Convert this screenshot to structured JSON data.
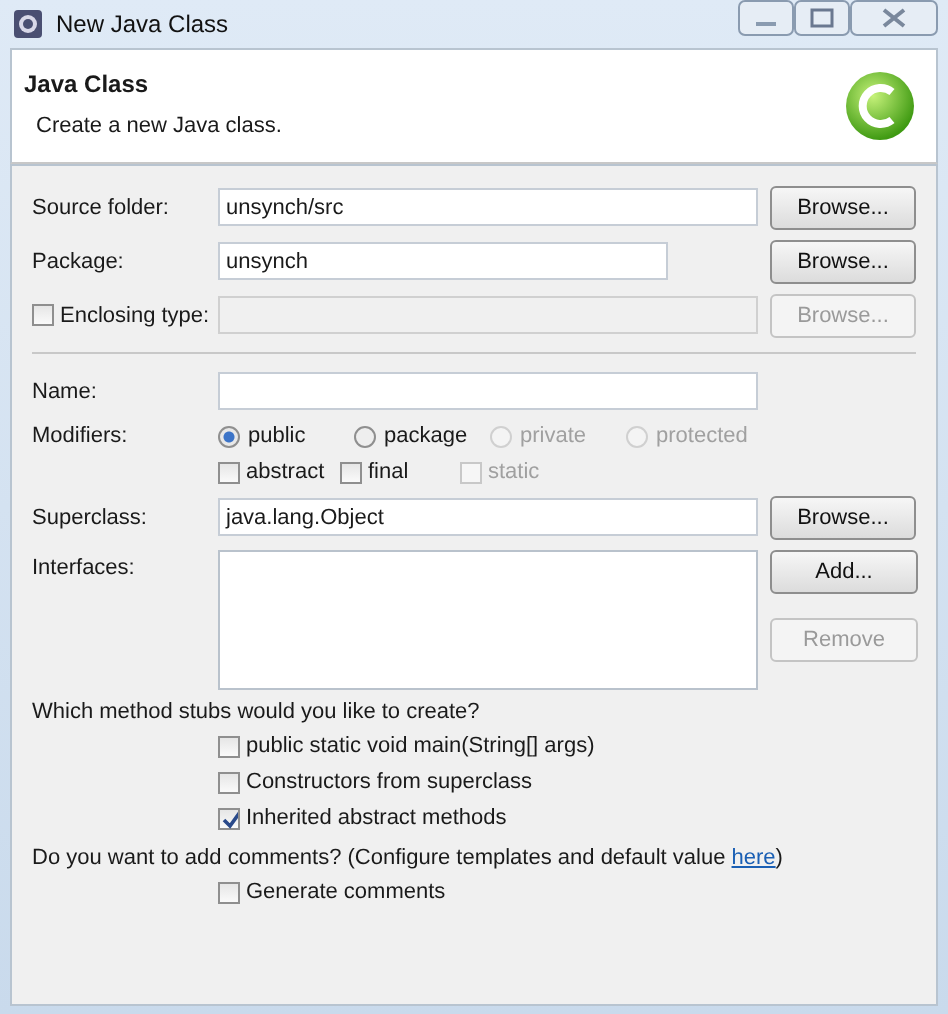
{
  "window": {
    "title": "New Java Class"
  },
  "header": {
    "title": "Java Class",
    "description": "Create a new Java class."
  },
  "location_rows": [
    {
      "kind": "text",
      "label": "Source folder:",
      "value": "unsynch/src",
      "field_disabled": false,
      "button": {
        "label": "Browse...",
        "disabled": false
      }
    },
    {
      "kind": "short",
      "label": "Package:",
      "value": "unsynch",
      "field_disabled": false,
      "button": {
        "label": "Browse...",
        "disabled": false
      }
    },
    {
      "kind": "checkbox",
      "label": "Enclosing type:",
      "checked": false,
      "field_disabled": true,
      "button": {
        "label": "Browse...",
        "disabled": true
      }
    }
  ],
  "name": {
    "label": "Name:"
  },
  "modifiers": {
    "label": "Modifiers:",
    "access": [
      {
        "label": "public",
        "selected": true,
        "disabled": false
      },
      {
        "label": "package",
        "selected": false,
        "disabled": false
      },
      {
        "label": "private",
        "selected": false,
        "disabled": true
      },
      {
        "label": "protected",
        "selected": false,
        "disabled": true
      }
    ],
    "flags": [
      {
        "label": "abstract",
        "checked": false,
        "disabled": false
      },
      {
        "label": "final",
        "checked": false,
        "disabled": false
      },
      {
        "label": "static",
        "checked": false,
        "disabled": true
      }
    ]
  },
  "superclass": {
    "label": "Superclass:",
    "value": "java.lang.Object",
    "button": {
      "label": "Browse...",
      "disabled": false
    }
  },
  "interfaces": {
    "label": "Interfaces:",
    "buttons": [
      {
        "label": "Add...",
        "disabled": false
      },
      {
        "label": "Remove",
        "disabled": true
      }
    ]
  },
  "stubs": {
    "question": "Which method stubs would you like to create?",
    "options": [
      {
        "label": "public static void main(String[] args)",
        "checked": false
      },
      {
        "label": "Constructors from superclass",
        "checked": false
      },
      {
        "label": "Inherited abstract methods",
        "checked": true
      }
    ]
  },
  "comments": {
    "question_before": "Do you want to add comments? (Configure templates and default value ",
    "link": "here",
    "question_after": ")",
    "options": [
      {
        "label": "Generate comments",
        "checked": false
      }
    ]
  }
}
